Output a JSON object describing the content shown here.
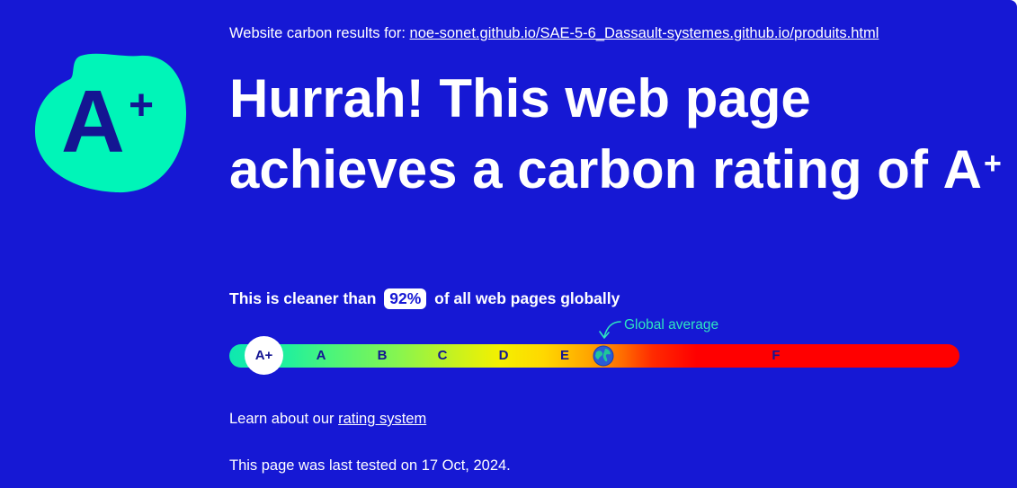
{
  "colors": {
    "background": "#1618d4",
    "accent": "#00f5b8",
    "grade_text": "#141592",
    "global_average_label": "#2ee6c0"
  },
  "grade": {
    "letter": "A",
    "modifier": "+"
  },
  "results": {
    "prefix": "Website carbon results for:",
    "url": "noe-sonet.github.io/SAE-5-6_Dassault-systemes.github.io/produits.html"
  },
  "headline": {
    "text": "Hurrah! This web page achieves a carbon rating of",
    "grade_letter": "A",
    "grade_modifier": "+"
  },
  "comparison": {
    "prefix": "This is cleaner than",
    "percent": "92%",
    "suffix": "of all web pages globally"
  },
  "scale": {
    "current": "A+",
    "labels": [
      "A",
      "B",
      "C",
      "D",
      "E",
      "F"
    ],
    "global_average_label": "Global average",
    "global_average_icon": "globe-icon"
  },
  "learn": {
    "prefix": "Learn about our",
    "link": "rating system"
  },
  "tested": {
    "text": "This page was last tested on 17 Oct, 2024."
  }
}
